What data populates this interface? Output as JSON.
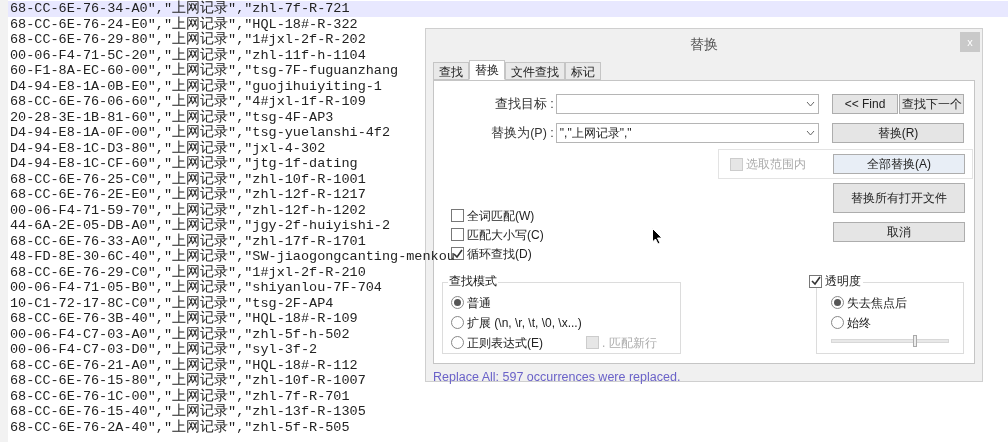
{
  "editor": {
    "lines": [
      {
        "text": "68-CC-6E-76-34-A0\",\"上网记录\",\"zhl-7f-R-721",
        "selected": true
      },
      {
        "text": "68-CC-6E-76-24-E0\",\"上网记录\",\"HQL-18#-R-322",
        "selected": false
      },
      {
        "text": "68-CC-6E-76-29-80\",\"上网记录\",\"1#jxl-2f-R-202",
        "selected": false
      },
      {
        "text": "00-06-F4-71-5C-20\",\"上网记录\",\"zhl-11f-h-1104",
        "selected": false
      },
      {
        "text": "60-F1-8A-EC-60-00\",\"上网记录\",\"tsg-7F-fuguanzhang",
        "selected": false
      },
      {
        "text": "D4-94-E8-1A-0B-E0\",\"上网记录\",\"guojihuiyiting-1",
        "selected": false
      },
      {
        "text": "68-CC-6E-76-06-60\",\"上网记录\",\"4#jxl-1f-R-109",
        "selected": false
      },
      {
        "text": "20-28-3E-1B-81-60\",\"上网记录\",\"tsg-4F-AP3",
        "selected": false
      },
      {
        "text": "D4-94-E8-1A-0F-00\",\"上网记录\",\"tsg-yuelanshi-4f2",
        "selected": false
      },
      {
        "text": "D4-94-E8-1C-D3-80\",\"上网记录\",\"jxl-4-302",
        "selected": false
      },
      {
        "text": "D4-94-E8-1C-CF-60\",\"上网记录\",\"jtg-1f-dating",
        "selected": false
      },
      {
        "text": "68-CC-6E-76-25-C0\",\"上网记录\",\"zhl-10f-R-1001",
        "selected": false
      },
      {
        "text": "68-CC-6E-76-2E-E0\",\"上网记录\",\"zhl-12f-R-1217",
        "selected": false
      },
      {
        "text": "00-06-F4-71-59-70\",\"上网记录\",\"zhl-12f-h-1202",
        "selected": false
      },
      {
        "text": "44-6A-2E-05-DB-A0\",\"上网记录\",\"jgy-2f-huiyishi-2",
        "selected": false
      },
      {
        "text": "68-CC-6E-76-33-A0\",\"上网记录\",\"zhl-17f-R-1701",
        "selected": false
      },
      {
        "text": "48-FD-8E-30-6C-40\",\"上网记录\",\"SW-jiaogongcanting-menkou",
        "selected": false
      },
      {
        "text": "68-CC-6E-76-29-C0\",\"上网记录\",\"1#jxl-2f-R-210",
        "selected": false
      },
      {
        "text": "00-06-F4-71-05-B0\",\"上网记录\",\"shiyanlou-7F-704",
        "selected": false
      },
      {
        "text": "10-C1-72-17-8C-C0\",\"上网记录\",\"tsg-2F-AP4",
        "selected": false
      },
      {
        "text": "68-CC-6E-76-3B-40\",\"上网记录\",\"HQL-18#-R-109",
        "selected": false
      },
      {
        "text": "00-06-F4-C7-03-A0\",\"上网记录\",\"zhl-5f-h-502",
        "selected": false
      },
      {
        "text": "00-06-F4-C7-03-D0\",\"上网记录\",\"syl-3f-2",
        "selected": false
      },
      {
        "text": "68-CC-6E-76-21-A0\",\"上网记录\",\"HQL-18#-R-112",
        "selected": false
      },
      {
        "text": "68-CC-6E-76-15-80\",\"上网记录\",\"zhl-10f-R-1007",
        "selected": false
      },
      {
        "text": "68-CC-6E-76-1C-00\",\"上网记录\",\"zhl-7f-R-701",
        "selected": false
      },
      {
        "text": "68-CC-6E-76-15-40\",\"上网记录\",\"zhl-13f-R-1305",
        "selected": false
      },
      {
        "text": "68-CC-6E-76-2A-40\",\"上网记录\",\"zhl-5f-R-505",
        "selected": false
      }
    ]
  },
  "dialog": {
    "title": "替换",
    "close": "x",
    "tabs": [
      {
        "label": "查找",
        "selected": false
      },
      {
        "label": "替换",
        "selected": true
      },
      {
        "label": "文件查找",
        "selected": false
      },
      {
        "label": "标记",
        "selected": false
      }
    ],
    "fields": [
      {
        "label": "查找目标 :"
      },
      {
        "label": "替换为(P) :",
        "value": "\",\"上网记录\",\""
      }
    ],
    "find_prev_button": "<< Find",
    "find_next_button": "查找下一个",
    "replace_button": "替换(R)",
    "in_selection": {
      "label": "选取范围内",
      "checked": false,
      "disabled": true
    },
    "replace_all_button": "全部替换(A)",
    "replace_all_open_button": "替换所有打开文件",
    "cancel_button": "取消",
    "options": [
      {
        "label": "全词匹配(W)",
        "checked": false
      },
      {
        "label": "匹配大小写(C)",
        "checked": false
      },
      {
        "label": "循环查找(D)",
        "checked": true
      }
    ],
    "search_mode": {
      "title": "查找模式",
      "options": [
        {
          "label": "普通",
          "selected": true
        },
        {
          "label": "扩展 (\\n, \\r, \\t, \\0, \\x...)",
          "selected": false
        },
        {
          "label": "正则表达式(E)",
          "selected": false
        }
      ],
      "dot_newline": {
        "label": ". 匹配新行",
        "checked": false,
        "disabled": true
      }
    },
    "transparency": {
      "label": "透明度",
      "checked": true,
      "options": [
        {
          "label": "失去焦点后",
          "selected": true
        },
        {
          "label": "始终",
          "selected": false
        }
      ],
      "level": 0.71
    },
    "status": "Replace All: 597 occurrences were replaced."
  }
}
